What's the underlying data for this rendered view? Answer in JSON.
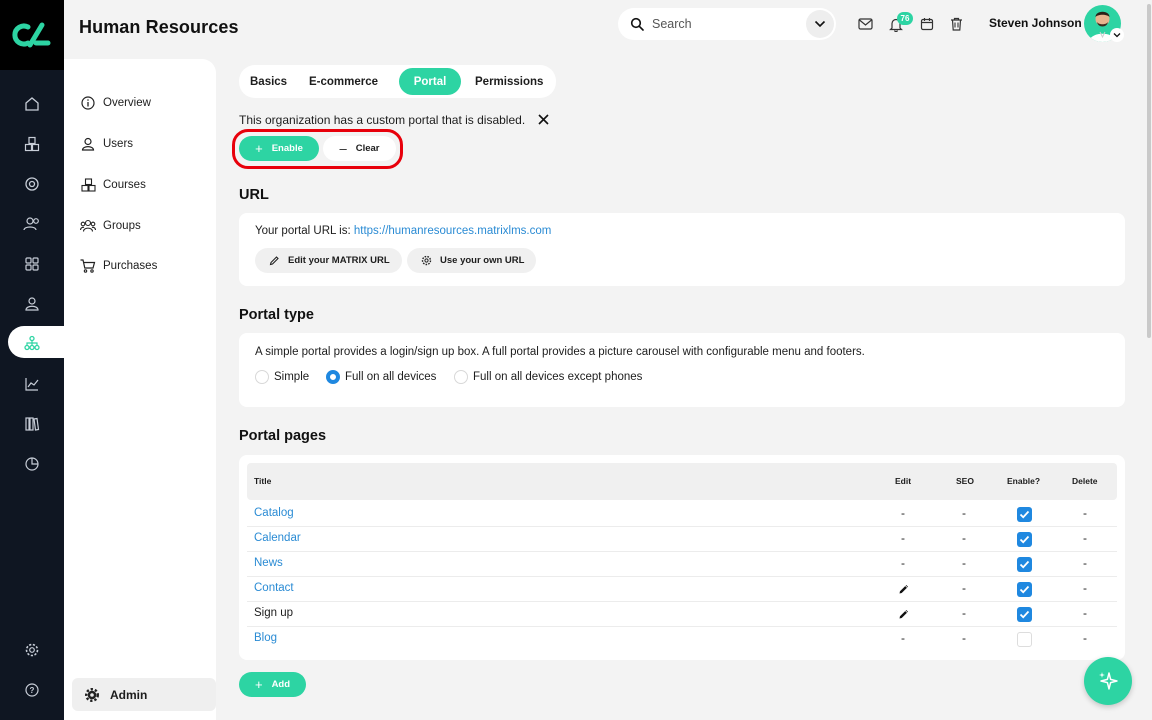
{
  "app": {
    "title": "Human Resources"
  },
  "header": {
    "search_placeholder": "Search",
    "notifications_count": "76",
    "user_name": "Steven Johnson"
  },
  "rail": {
    "icons": [
      "home-icon",
      "bundles-icon",
      "target-icon",
      "people-icon",
      "grid-icon",
      "user-icon",
      "org-chart-icon",
      "chart-icon",
      "library-icon",
      "pie-chart-icon",
      "settings-icon",
      "help-icon"
    ],
    "active": "org-chart-icon"
  },
  "subnav": {
    "items": [
      {
        "label": "Overview",
        "icon": "info-icon"
      },
      {
        "label": "Users",
        "icon": "user-icon"
      },
      {
        "label": "Courses",
        "icon": "courses-icon"
      },
      {
        "label": "Groups",
        "icon": "groups-icon"
      },
      {
        "label": "Purchases",
        "icon": "cart-icon"
      }
    ],
    "admin_label": "Admin"
  },
  "tabs": [
    {
      "label": "Basics",
      "active": false
    },
    {
      "label": "E-commerce",
      "active": false
    },
    {
      "label": "Portal",
      "active": true
    },
    {
      "label": "Permissions",
      "active": false
    }
  ],
  "notice": {
    "text": "This organization has a custom portal that is disabled.",
    "enable_label": "Enable",
    "clear_label": "Clear"
  },
  "url_section": {
    "title": "URL",
    "prefix": "Your portal URL is: ",
    "url": "https://humanresources.matrixlms.com",
    "edit_label": "Edit your MATRIX URL",
    "own_label": "Use your own URL"
  },
  "portal_type": {
    "title": "Portal type",
    "description": "A simple portal provides a login/sign up box. A full portal provides a picture carousel with configurable menu and footers.",
    "options": [
      {
        "label": "Simple",
        "selected": false
      },
      {
        "label": "Full on all devices",
        "selected": true
      },
      {
        "label": "Full on all devices except phones",
        "selected": false
      }
    ]
  },
  "portal_pages": {
    "title": "Portal pages",
    "columns": [
      "Title",
      "Edit",
      "SEO",
      "Enable?",
      "Delete"
    ],
    "rows": [
      {
        "title": "Catalog",
        "link": true,
        "edit": "-",
        "seo": "-",
        "enabled": true,
        "delete": "-"
      },
      {
        "title": "Calendar",
        "link": true,
        "edit": "-",
        "seo": "-",
        "enabled": true,
        "delete": "-"
      },
      {
        "title": "News",
        "link": true,
        "edit": "-",
        "seo": "-",
        "enabled": true,
        "delete": "-"
      },
      {
        "title": "Contact",
        "link": true,
        "edit": "pencil",
        "seo": "-",
        "enabled": true,
        "delete": "-"
      },
      {
        "title": "Sign up",
        "link": false,
        "edit": "pencil",
        "seo": "-",
        "enabled": true,
        "delete": "-"
      },
      {
        "title": "Blog",
        "link": true,
        "edit": "-",
        "seo": "-",
        "enabled": false,
        "delete": "-"
      }
    ],
    "add_label": "Add"
  },
  "colors": {
    "accent": "#2dd4a3",
    "link": "#2a8bd4",
    "rail": "#0f1622",
    "highlight": "#e8000b"
  }
}
